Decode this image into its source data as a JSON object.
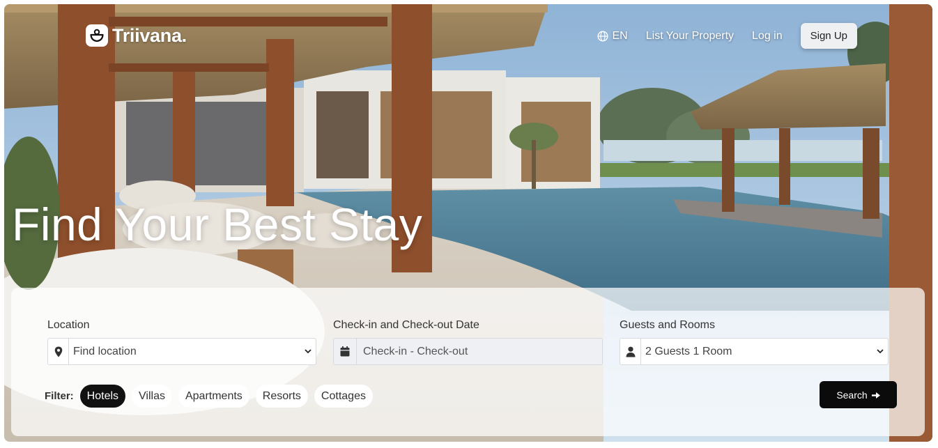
{
  "brand": {
    "name": "Triivana."
  },
  "nav": {
    "language": "EN",
    "list_property": "List Your Property",
    "login": "Log in",
    "signup": "Sign Up"
  },
  "hero": {
    "headline": "Find Your Best Stay"
  },
  "search": {
    "location": {
      "label": "Location",
      "value": "Find location",
      "icon": "map-pin-icon"
    },
    "dates": {
      "label": "Check-in and Check-out Date",
      "value": "Check-in - Check-out",
      "icon": "calendar-icon"
    },
    "guests": {
      "label": "Guests and Rooms",
      "value": "2 Guests 1 Room",
      "icon": "user-icon"
    },
    "filter_label": "Filter:",
    "filters": [
      {
        "label": "Hotels",
        "active": true
      },
      {
        "label": "Villas",
        "active": false
      },
      {
        "label": "Apartments",
        "active": false
      },
      {
        "label": "Resorts",
        "active": false
      },
      {
        "label": "Cottages",
        "active": false
      }
    ],
    "button_label": "Search",
    "button_icon": "arrow-right-icon"
  },
  "colors": {
    "accent": "#0b0b0b",
    "panel": "#ffffff",
    "text": "#333333"
  }
}
